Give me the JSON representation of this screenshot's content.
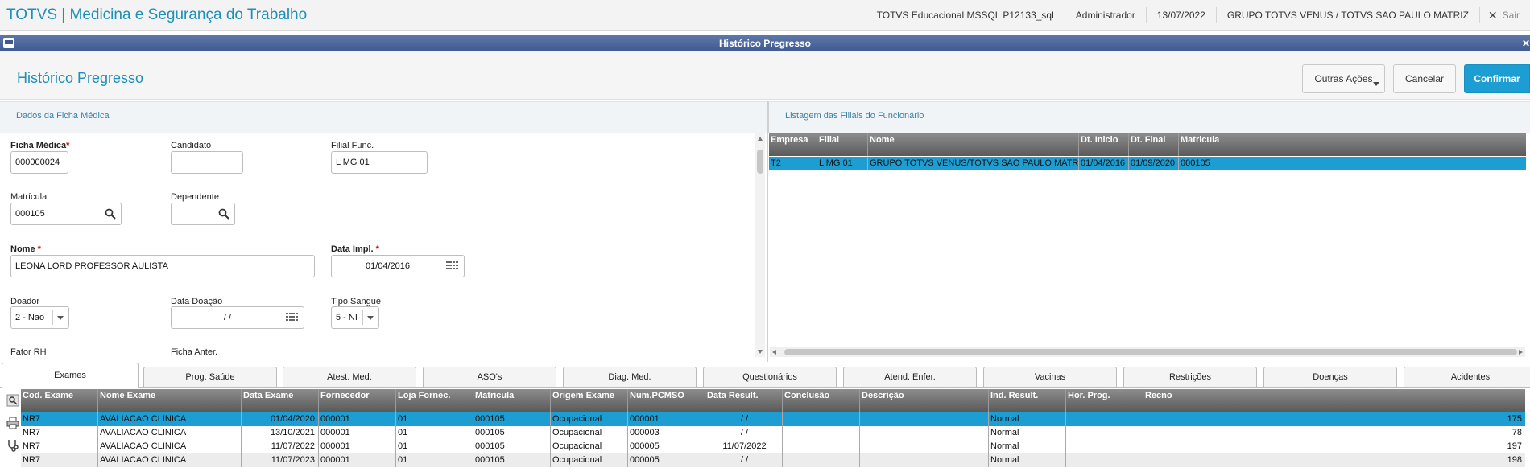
{
  "topbar": {
    "app_title": "TOTVS | Medicina e Segurança do Trabalho",
    "environment": "TOTVS Educacional MSSQL P12133_sql",
    "user": "Administrador",
    "date": "13/07/2022",
    "company": "GRUPO TOTVS VENUS / TOTVS SAO PAULO MATRIZ",
    "logout_label": "Sair"
  },
  "window": {
    "title": "Histórico Pregresso"
  },
  "header": {
    "page_title": "Histórico Pregresso",
    "other_actions_label": "Outras Ações",
    "cancel_label": "Cancelar",
    "confirm_label": "Confirmar"
  },
  "left_panel": {
    "title": "Dados da Ficha Médica",
    "fields": {
      "ficha_medica": {
        "label": "Ficha Médica",
        "value": "000000024"
      },
      "candidato": {
        "label": "Candidato",
        "value": ""
      },
      "filial_func": {
        "label": "Filial Func.",
        "value": "L MG 01"
      },
      "matricula": {
        "label": "Matrícula",
        "value": "000105"
      },
      "dependente": {
        "label": "Dependente",
        "value": ""
      },
      "nome": {
        "label": "Nome",
        "value": "LEONA LORD PROFESSOR AULISTA"
      },
      "data_impl": {
        "label": "Data Impl.",
        "value": "01/04/2016"
      },
      "doador": {
        "label": "Doador",
        "value": "2 - Nao"
      },
      "data_doacao": {
        "label": "Data Doação",
        "value": " /  /"
      },
      "tipo_sangue": {
        "label": "Tipo Sangue",
        "value": "5 - NI"
      },
      "fator_rh": {
        "label": "Fator RH"
      },
      "ficha_anter": {
        "label": "Ficha Anter."
      }
    }
  },
  "right_panel": {
    "title": "Listagem das Filiais do Funcionário",
    "columns": [
      "Empresa",
      "Filial",
      "Nome",
      "Dt. Inicio",
      "Dt. Final",
      "Matricula"
    ],
    "rows": [
      [
        "T2",
        "L MG 01",
        "GRUPO TOTVS VENUS/TOTVS SAO PAULO MATRIZ",
        "01/04/2016",
        "01/09/2020",
        "000105"
      ]
    ]
  },
  "tabs": [
    "Exames",
    "Prog. Saúde",
    "Atest. Med.",
    "ASO's",
    "Diag. Med.",
    "Questionários",
    "Atend. Enfer.",
    "Vacinas",
    "Restrições",
    "Doenças",
    "Acidentes"
  ],
  "exams_grid": {
    "columns": [
      "Cod. Exame",
      "Nome Exame",
      "Data Exame",
      "Fornecedor",
      "Loja Fornec.",
      "Matricula",
      "Origem Exame",
      "Num.PCMSO",
      "Data Result.",
      "Conclusão",
      "Descrição",
      "Ind. Result.",
      "Hor. Prog.",
      "Recno"
    ],
    "rows": [
      [
        "NR7",
        "AVALIACAO CLINICA",
        "01/04/2020",
        "000001",
        "01",
        "000105",
        "Ocupacional",
        "000001",
        " /  /",
        "",
        "",
        "Normal",
        "",
        "175"
      ],
      [
        "NR7",
        "AVALIACAO CLINICA",
        "13/10/2021",
        "000001",
        "01",
        "000105",
        "Ocupacional",
        "000003",
        " /  /",
        "",
        "",
        "Normal",
        "",
        "78"
      ],
      [
        "NR7",
        "AVALIACAO CLINICA",
        "11/07/2022",
        "000001",
        "01",
        "000105",
        "Ocupacional",
        "000005",
        "11/07/2022",
        "",
        "",
        "Normal",
        "",
        "197"
      ],
      [
        "NR7",
        "AVALIACAO CLINICA",
        "11/07/2023",
        "000001",
        "01",
        "000105",
        "Ocupacional",
        "000005",
        " /  /",
        "",
        "",
        "Normal",
        "",
        "198"
      ]
    ]
  },
  "colors": {
    "accent": "#1d9ed2",
    "title_blue": "#1d90b8",
    "window_bar": "#3f5a92",
    "required": "#d10000"
  },
  "icons": [
    "search-icon",
    "calendar-icon",
    "close-icon",
    "window-icon",
    "print-icon",
    "stethoscope-icon"
  ]
}
